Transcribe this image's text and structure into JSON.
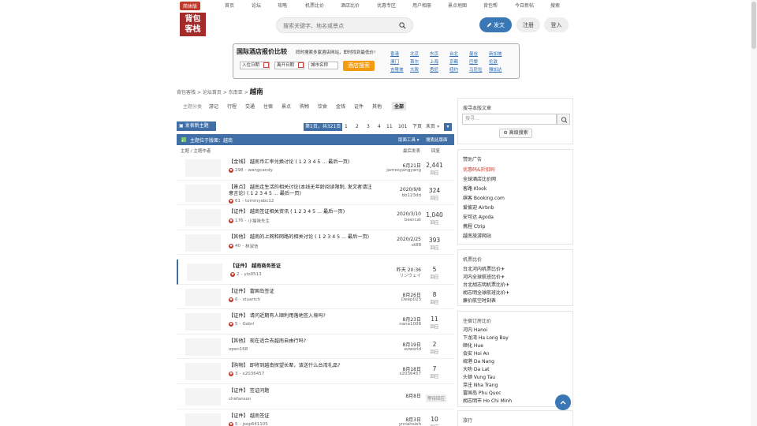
{
  "topnav": {
    "simplified_label": "简体版",
    "items": [
      "首页",
      "论坛",
      "攻略",
      "机票比价",
      "酒店比价",
      "优惠专区",
      "用户相册",
      "景点地图",
      "背包帮",
      "今日新帖",
      "搜索"
    ]
  },
  "logo": {
    "line1": "背包",
    "line2": "客栈"
  },
  "search": {
    "placeholder": "搜索关键字、地名或景点"
  },
  "header_buttons": {
    "post": "发文",
    "register": "注册",
    "login": "登入"
  },
  "hotel": {
    "title": "国际酒店报价比较",
    "desc": "同时搜索多家酒店网站，即时找到最低价!",
    "checkin": "入住日期",
    "checkout": "离开日期",
    "city_placeholder": "城市名称",
    "search_btn": "酒店搜索",
    "cities_row1": [
      "香港",
      "北京",
      "东京",
      "台北",
      "曼谷",
      "新加坡"
    ],
    "cities_row2": [
      "澳门",
      "首尔",
      "上海",
      "京都",
      "巴黎",
      "伦敦"
    ],
    "cities_row3": [
      "吉隆坡",
      "大阪",
      "悉尼",
      "纽约",
      "马尼拉",
      "雅加达"
    ]
  },
  "breadcrumb": {
    "items": [
      "背包客栈",
      "论坛首页",
      "东南亚"
    ],
    "sep": ">",
    "current": "越南"
  },
  "categories": [
    "主题分类",
    "游记",
    "行程",
    "交通",
    "住宿",
    "景点",
    "购物",
    "饮食",
    "金钱",
    "证件",
    "其他",
    "全部"
  ],
  "newthread": "发表新主题",
  "pager": {
    "info": "第1页，共321页",
    "pages": [
      "1",
      "2",
      "3",
      "4",
      "11",
      "101"
    ],
    "next": "下页",
    "last": "末页 »"
  },
  "forumbar": {
    "title": "主题位于版面：越南",
    "tools": "版面工具 ▾",
    "search": "搜索此版面"
  },
  "colhead": {
    "topic": "主题 / 主题作者",
    "last": "最后发表",
    "replies": "回复"
  },
  "threads": [
    {
      "title": "【金钱】 越南币汇率兑换讨论 ( 1 2 3 4 5 ... 最后一页)",
      "likes": "298",
      "author": "wangcandy",
      "date": "6月21日",
      "last": "jamesyangyang",
      "count": "2,441",
      "replies_label": "回应",
      "pinned": true
    },
    {
      "title": "【景点】 越南走生活的相关讨论(本线无年龄阅读限制, 发文者请注意言论) ( 1 2 3 4 5 ... 最后一页)",
      "likes": "61",
      "author": "tommyabc12",
      "date": "2020/9/8",
      "last": "bb123dd",
      "count": "324",
      "replies_label": "回应",
      "pinned": true
    },
    {
      "title": "【证件】 越南签证相关资讯 ( 1 2 3 4 5 ... 最后一页)",
      "likes": "176",
      "author": "小猫咪先生",
      "date": "2020/3/10",
      "last": "beercat",
      "count": "1,040",
      "replies_label": "回应",
      "pinned": true
    },
    {
      "title": "【其他】 越南的上网和网路的相关讨论 ( 1 2 3 4 5 ... 最后一页)",
      "likes": "40",
      "author": "林淑信",
      "date": "2020/2/25",
      "last": "st88",
      "count": "393",
      "replies_label": "回应",
      "pinned": true
    },
    {
      "title": "【证件】 越南商务签证",
      "likes": "2",
      "author": "yio0513",
      "date": "昨天 20:36",
      "last": "リンウェイ",
      "count": "5",
      "replies_label": "回应",
      "pinned": false
    },
    {
      "title": "【证件】 富国岛签证",
      "likes": "6",
      "author": "stuartch",
      "date": "8月26日",
      "last": "Deep023",
      "count": "8",
      "replies_label": "回应",
      "pinned": false
    },
    {
      "title": "【证件】 请问近期有人顺利用落地签入境吗?",
      "likes": "5",
      "author": "Gabri",
      "date": "8月23日",
      "last": "nana1008",
      "count": "11",
      "replies_label": "回应",
      "pinned": false
    },
    {
      "title": "【其他】 现在适合去越南自由行吗?",
      "likes": "",
      "author": "open168",
      "date": "8月19日",
      "last": "ezworld",
      "count": "2",
      "replies_label": "回应",
      "pinned": false
    },
    {
      "title": "【购物】 即将到越南探望长辈，该送什么台湾礼品?",
      "likes": "3",
      "author": "x2036457",
      "date": "8月18日",
      "last": "x2036457",
      "count": "7",
      "replies_label": "回应",
      "pinned": false
    },
    {
      "title": "【证件】 签证问题",
      "likes": "",
      "author": "chefanson",
      "date": "8月8日",
      "last": "",
      "count": "",
      "replies_label": "",
      "wait": "等待回应",
      "pinned": false
    },
    {
      "title": "【证件】 越南签证",
      "likes": "5",
      "author": "jsop641105",
      "date": "8月3日",
      "last": "ynnahsieh",
      "count": "10",
      "replies_label": "回应",
      "pinned": false
    }
  ],
  "sidebar": {
    "search": {
      "title": "搜寻本版文章",
      "placeholder": "搜寻…",
      "adv": "高级搜索"
    },
    "ads": {
      "title": "赞助广告",
      "items": [
        "优惠码&折扣码",
        "全球酒店比价网",
        "客路 Klook",
        "缤客 Booking.com",
        "爱彼迎 Airbnb",
        "安可达 Agoda",
        "携程 Ctrip",
        "越南旅游网站"
      ]
    },
    "flights": {
      "title": "机票比价",
      "items": [
        "台北河内机票比价✈",
        "河内全球航班比价✈",
        "台北胡志明机票比价✈",
        "胡志明全球航班比价✈",
        "廉价航空时刻表"
      ]
    },
    "hotels": {
      "title": "住宿订房比价",
      "items": [
        "河内 Hanoi",
        "下龙湾 Ha Long Bay",
        "顺化 Hue",
        "会安 Hoi An",
        "岘港 Da Nang",
        "大叻 Da Lat",
        "头顿 Vung Tau",
        "芽庄 Nha Trang",
        "富国岛 Phu Quoc",
        "胡志明市 Ho Chi Minh"
      ]
    },
    "tours": {
      "title": "旅行"
    }
  }
}
